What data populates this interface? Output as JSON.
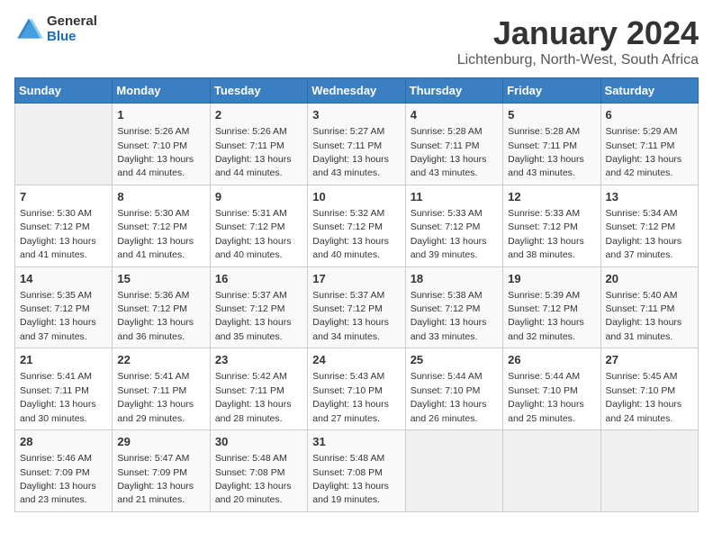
{
  "header": {
    "logo_general": "General",
    "logo_blue": "Blue",
    "title": "January 2024",
    "subtitle": "Lichtenburg, North-West, South Africa"
  },
  "days_of_week": [
    "Sunday",
    "Monday",
    "Tuesday",
    "Wednesday",
    "Thursday",
    "Friday",
    "Saturday"
  ],
  "weeks": [
    [
      {
        "day": "",
        "sunrise": "",
        "sunset": "",
        "daylight": ""
      },
      {
        "day": "1",
        "sunrise": "Sunrise: 5:26 AM",
        "sunset": "Sunset: 7:10 PM",
        "daylight": "Daylight: 13 hours and 44 minutes."
      },
      {
        "day": "2",
        "sunrise": "Sunrise: 5:26 AM",
        "sunset": "Sunset: 7:11 PM",
        "daylight": "Daylight: 13 hours and 44 minutes."
      },
      {
        "day": "3",
        "sunrise": "Sunrise: 5:27 AM",
        "sunset": "Sunset: 7:11 PM",
        "daylight": "Daylight: 13 hours and 43 minutes."
      },
      {
        "day": "4",
        "sunrise": "Sunrise: 5:28 AM",
        "sunset": "Sunset: 7:11 PM",
        "daylight": "Daylight: 13 hours and 43 minutes."
      },
      {
        "day": "5",
        "sunrise": "Sunrise: 5:28 AM",
        "sunset": "Sunset: 7:11 PM",
        "daylight": "Daylight: 13 hours and 43 minutes."
      },
      {
        "day": "6",
        "sunrise": "Sunrise: 5:29 AM",
        "sunset": "Sunset: 7:11 PM",
        "daylight": "Daylight: 13 hours and 42 minutes."
      }
    ],
    [
      {
        "day": "7",
        "sunrise": "Sunrise: 5:30 AM",
        "sunset": "Sunset: 7:12 PM",
        "daylight": "Daylight: 13 hours and 41 minutes."
      },
      {
        "day": "8",
        "sunrise": "Sunrise: 5:30 AM",
        "sunset": "Sunset: 7:12 PM",
        "daylight": "Daylight: 13 hours and 41 minutes."
      },
      {
        "day": "9",
        "sunrise": "Sunrise: 5:31 AM",
        "sunset": "Sunset: 7:12 PM",
        "daylight": "Daylight: 13 hours and 40 minutes."
      },
      {
        "day": "10",
        "sunrise": "Sunrise: 5:32 AM",
        "sunset": "Sunset: 7:12 PM",
        "daylight": "Daylight: 13 hours and 40 minutes."
      },
      {
        "day": "11",
        "sunrise": "Sunrise: 5:33 AM",
        "sunset": "Sunset: 7:12 PM",
        "daylight": "Daylight: 13 hours and 39 minutes."
      },
      {
        "day": "12",
        "sunrise": "Sunrise: 5:33 AM",
        "sunset": "Sunset: 7:12 PM",
        "daylight": "Daylight: 13 hours and 38 minutes."
      },
      {
        "day": "13",
        "sunrise": "Sunrise: 5:34 AM",
        "sunset": "Sunset: 7:12 PM",
        "daylight": "Daylight: 13 hours and 37 minutes."
      }
    ],
    [
      {
        "day": "14",
        "sunrise": "Sunrise: 5:35 AM",
        "sunset": "Sunset: 7:12 PM",
        "daylight": "Daylight: 13 hours and 37 minutes."
      },
      {
        "day": "15",
        "sunrise": "Sunrise: 5:36 AM",
        "sunset": "Sunset: 7:12 PM",
        "daylight": "Daylight: 13 hours and 36 minutes."
      },
      {
        "day": "16",
        "sunrise": "Sunrise: 5:37 AM",
        "sunset": "Sunset: 7:12 PM",
        "daylight": "Daylight: 13 hours and 35 minutes."
      },
      {
        "day": "17",
        "sunrise": "Sunrise: 5:37 AM",
        "sunset": "Sunset: 7:12 PM",
        "daylight": "Daylight: 13 hours and 34 minutes."
      },
      {
        "day": "18",
        "sunrise": "Sunrise: 5:38 AM",
        "sunset": "Sunset: 7:12 PM",
        "daylight": "Daylight: 13 hours and 33 minutes."
      },
      {
        "day": "19",
        "sunrise": "Sunrise: 5:39 AM",
        "sunset": "Sunset: 7:12 PM",
        "daylight": "Daylight: 13 hours and 32 minutes."
      },
      {
        "day": "20",
        "sunrise": "Sunrise: 5:40 AM",
        "sunset": "Sunset: 7:11 PM",
        "daylight": "Daylight: 13 hours and 31 minutes."
      }
    ],
    [
      {
        "day": "21",
        "sunrise": "Sunrise: 5:41 AM",
        "sunset": "Sunset: 7:11 PM",
        "daylight": "Daylight: 13 hours and 30 minutes."
      },
      {
        "day": "22",
        "sunrise": "Sunrise: 5:41 AM",
        "sunset": "Sunset: 7:11 PM",
        "daylight": "Daylight: 13 hours and 29 minutes."
      },
      {
        "day": "23",
        "sunrise": "Sunrise: 5:42 AM",
        "sunset": "Sunset: 7:11 PM",
        "daylight": "Daylight: 13 hours and 28 minutes."
      },
      {
        "day": "24",
        "sunrise": "Sunrise: 5:43 AM",
        "sunset": "Sunset: 7:10 PM",
        "daylight": "Daylight: 13 hours and 27 minutes."
      },
      {
        "day": "25",
        "sunrise": "Sunrise: 5:44 AM",
        "sunset": "Sunset: 7:10 PM",
        "daylight": "Daylight: 13 hours and 26 minutes."
      },
      {
        "day": "26",
        "sunrise": "Sunrise: 5:44 AM",
        "sunset": "Sunset: 7:10 PM",
        "daylight": "Daylight: 13 hours and 25 minutes."
      },
      {
        "day": "27",
        "sunrise": "Sunrise: 5:45 AM",
        "sunset": "Sunset: 7:10 PM",
        "daylight": "Daylight: 13 hours and 24 minutes."
      }
    ],
    [
      {
        "day": "28",
        "sunrise": "Sunrise: 5:46 AM",
        "sunset": "Sunset: 7:09 PM",
        "daylight": "Daylight: 13 hours and 23 minutes."
      },
      {
        "day": "29",
        "sunrise": "Sunrise: 5:47 AM",
        "sunset": "Sunset: 7:09 PM",
        "daylight": "Daylight: 13 hours and 21 minutes."
      },
      {
        "day": "30",
        "sunrise": "Sunrise: 5:48 AM",
        "sunset": "Sunset: 7:08 PM",
        "daylight": "Daylight: 13 hours and 20 minutes."
      },
      {
        "day": "31",
        "sunrise": "Sunrise: 5:48 AM",
        "sunset": "Sunset: 7:08 PM",
        "daylight": "Daylight: 13 hours and 19 minutes."
      },
      {
        "day": "",
        "sunrise": "",
        "sunset": "",
        "daylight": ""
      },
      {
        "day": "",
        "sunrise": "",
        "sunset": "",
        "daylight": ""
      },
      {
        "day": "",
        "sunrise": "",
        "sunset": "",
        "daylight": ""
      }
    ]
  ]
}
